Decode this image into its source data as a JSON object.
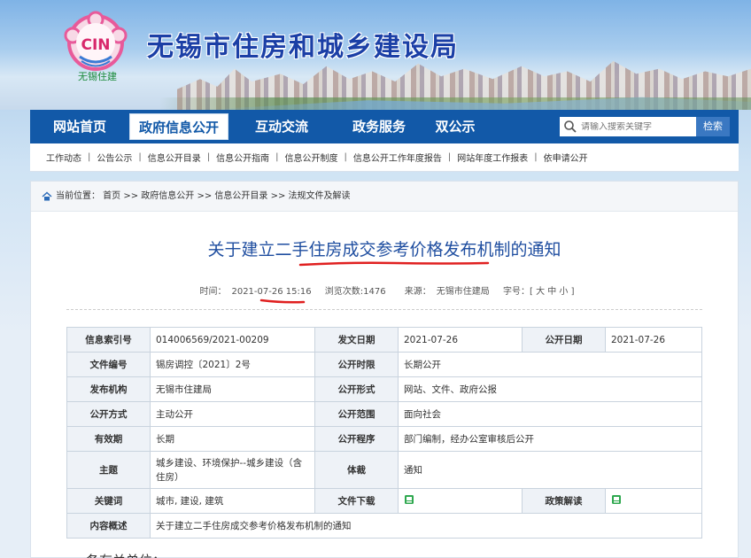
{
  "header": {
    "site_title": "无锡市住房和城乡建设局",
    "logo_text": "CIN",
    "logo_sub": "无锡住建"
  },
  "nav": {
    "items": [
      {
        "label": "网站首页"
      },
      {
        "label": "政府信息公开"
      },
      {
        "label": "互动交流"
      },
      {
        "label": "政务服务"
      },
      {
        "label": "双公示"
      }
    ],
    "active_index": 1,
    "search_placeholder": "请输入搜索关键字",
    "search_button": "检索"
  },
  "subnav": {
    "items": [
      "工作动态",
      "公告公示",
      "信息公开目录",
      "信息公开指南",
      "信息公开制度",
      "信息公开工作年度报告",
      "网站年度工作报表",
      "依申请公开"
    ]
  },
  "breadcrumb": "当前位置： 首页 >> 政府信息公开 >> 信息公开目录 >> 法规文件及解读",
  "article": {
    "title": "关于建立二手住房成交参考价格发布机制的通知",
    "time_label": "时间：",
    "time": "2021-07-26 15:16",
    "views": "浏览次数:1476",
    "source_label": "来源：",
    "source": "无锡市住建局",
    "font_size": "字号：[ 大 中 小 ]"
  },
  "info_table": {
    "r1": {
      "l1": "信息索引号",
      "v1": "014006569/2021-00209",
      "l2": "发文日期",
      "v2": "2021-07-26",
      "l3": "公开日期",
      "v3": "2021-07-26"
    },
    "r2": {
      "l1": "文件编号",
      "v1": "锡房调控〔2021〕2号",
      "l2": "公开时限",
      "v2": "长期公开"
    },
    "r3": {
      "l1": "发布机构",
      "v1": "无锡市住建局",
      "l2": "公开形式",
      "v2": "网站、文件、政府公报"
    },
    "r4": {
      "l1": "公开方式",
      "v1": "主动公开",
      "l2": "公开范围",
      "v2": "面向社会"
    },
    "r5": {
      "l1": "有效期",
      "v1": "长期",
      "l2": "公开程序",
      "v2": "部门编制，经办公室审核后公开"
    },
    "r6": {
      "l1": "主题",
      "v1": "城乡建设、环境保护--城乡建设（含住房）",
      "l2": "体裁",
      "v2": "通知"
    },
    "r7": {
      "l1": "关键词",
      "v1": "城市, 建设, 建筑",
      "l2": "文件下载",
      "l3": "政策解读"
    },
    "r8": {
      "l1": "内容概述",
      "v1": "关于建立二手住房成交参考价格发布机制的通知"
    }
  },
  "body_start": "各有关单位：",
  "colors": {
    "nav_bg": "#1259a8",
    "title_blue": "#1f4ea0",
    "annotation_red": "#e02020"
  }
}
